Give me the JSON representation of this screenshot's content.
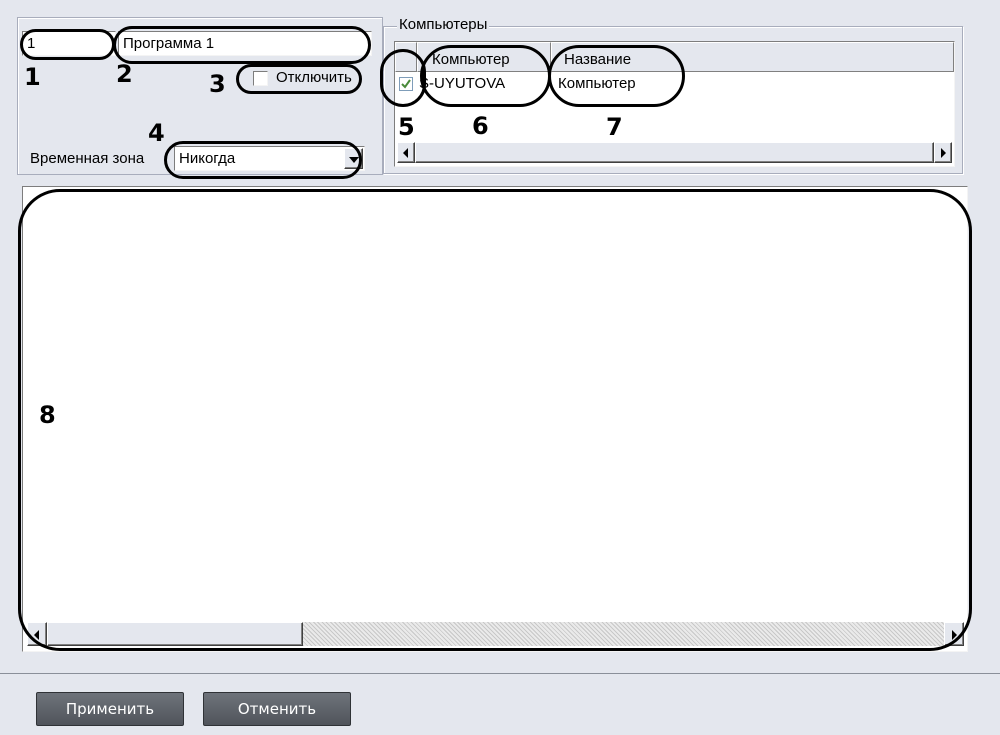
{
  "program": {
    "number_value": "1",
    "name_value": "Программа 1",
    "disable_label": "Отключить",
    "disable_checked": false,
    "time_zone_label": "Временная зона",
    "time_zone_value": "Никогда"
  },
  "computers": {
    "group_title": "Компьютеры",
    "columns": [
      "Компьютер",
      "Название"
    ],
    "rows": [
      {
        "checked": true,
        "computer": "S-UYUTOVA",
        "name": "Компьютер"
      }
    ]
  },
  "callouts": [
    "1",
    "2",
    "3",
    "4",
    "5",
    "6",
    "7",
    "8"
  ],
  "footer": {
    "apply_label": "Применить",
    "cancel_label": "Отменить"
  },
  "colors": {
    "background": "#e4e7ee",
    "footer_background": "#e4e7ee",
    "button_fill": "#5a5e65",
    "annotation": "#000000"
  }
}
